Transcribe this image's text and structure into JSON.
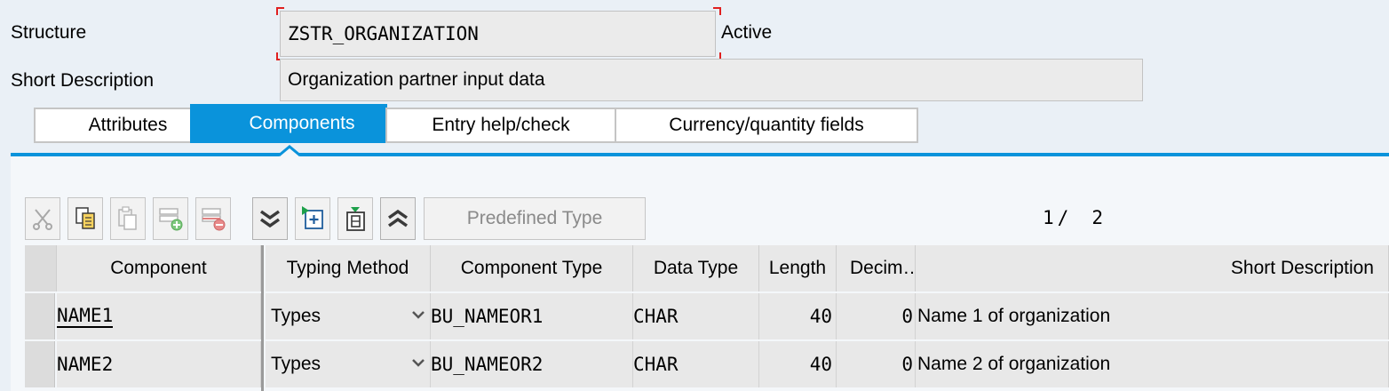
{
  "header": {
    "structure_label": "Structure",
    "structure_value": "ZSTR_ORGANIZATION",
    "status": "Active",
    "short_desc_label": "Short Description",
    "short_desc_value": "Organization partner input data"
  },
  "tabs": [
    {
      "label": "Attributes",
      "active": false
    },
    {
      "label": "Components",
      "active": true
    },
    {
      "label": "Entry help/check",
      "active": false
    },
    {
      "label": "Currency/quantity fields",
      "active": false
    }
  ],
  "toolbar": {
    "icons": [
      "cut-icon",
      "copy-icon",
      "paste-icon",
      "insert-row-icon",
      "delete-row-icon",
      "expand-all-icon",
      "insert-icon",
      "copy-down-icon",
      "collapse-all-icon"
    ],
    "predefined_type_label": "Predefined Type",
    "page_current": "1",
    "page_sep": "/",
    "page_total": "2"
  },
  "table": {
    "columns": [
      "Component",
      "Typing Method",
      "Component Type",
      "Data Type",
      "Length",
      "Decim…",
      "Short Description"
    ],
    "rows": [
      {
        "component": "NAME1",
        "typing_method": "Types",
        "component_type": "BU_NAMEOR1",
        "data_type": "CHAR",
        "length": "40",
        "decimals": "0",
        "short_description": "Name 1 of organization"
      },
      {
        "component": "NAME2",
        "typing_method": "Types",
        "component_type": "BU_NAMEOR2",
        "data_type": "CHAR",
        "length": "40",
        "decimals": "0",
        "short_description": "Name 2 of organization"
      }
    ]
  },
  "colors": {
    "accent": "#0a93db",
    "background": "#eaf0f6",
    "focus_corner": "#e02020"
  }
}
